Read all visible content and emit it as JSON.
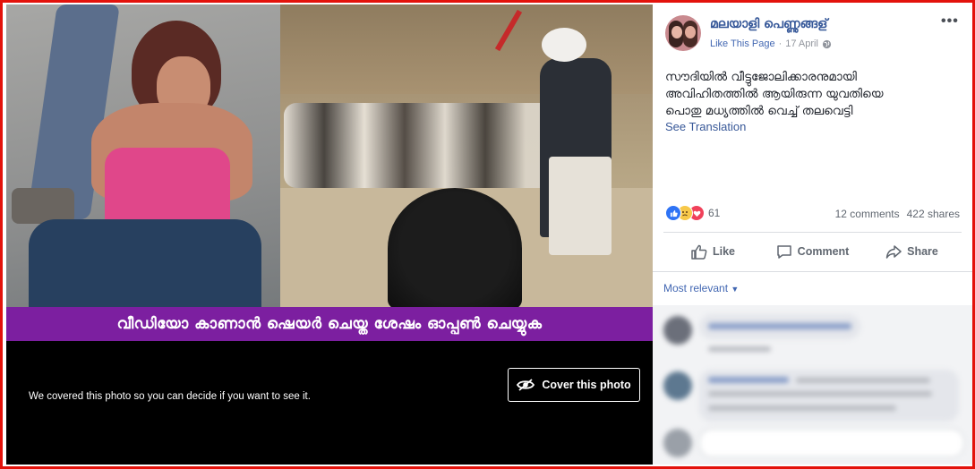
{
  "post": {
    "page_name": "മലയാളി പെണ്ണുങ്ങള്",
    "like_page_label": "Like This Page",
    "separator": "·",
    "date": "17 April",
    "more_icon": "more-options-icon",
    "text_line1": "സൗദിയിൽ വീട്ടുജോലിക്കാരനുമായി",
    "text_line2": "അവിഹിതത്തിൽ ആയിരുന്ന യുവതിയെ",
    "text_line3": "പൊതു മധ്യത്തിൽ വെച്ച് തലവെട്ടി",
    "see_translation": "See Translation"
  },
  "media": {
    "banner_text": "വീഡിയോ കാണാൻ ഷെയർ ചെയ്ത ശേഷം ഓപ്പൺ ചെയ്യുക",
    "cover_notice": "We covered this photo so you can decide if you want to see it.",
    "cover_button": "Cover this photo"
  },
  "engagement": {
    "reaction_count": "61",
    "reactions": [
      "like",
      "sad",
      "love"
    ],
    "comments": "12 comments",
    "shares": "422 shares"
  },
  "actions": {
    "like": "Like",
    "comment": "Comment",
    "share": "Share"
  },
  "comments_section": {
    "sort_label": "Most relevant"
  },
  "colors": {
    "frame_border": "#e3120b",
    "banner_bg": "#7c1fa0",
    "link_blue": "#385898"
  }
}
